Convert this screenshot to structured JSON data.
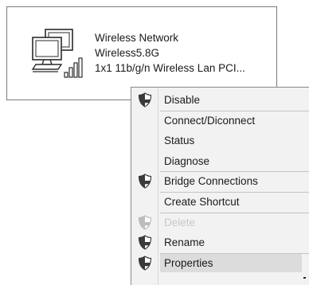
{
  "adapter": {
    "name": "Wireless Network",
    "network": "Wireless5.8G",
    "device": "1x1 11b/g/n Wireless Lan PCI...",
    "icon": "network-computers-signal-icon"
  },
  "context_menu": {
    "items": [
      {
        "label": "Disable",
        "shield": true,
        "enabled": true
      },
      {
        "label": "Connect/Diconnect",
        "shield": false,
        "enabled": true
      },
      {
        "label": "Status",
        "shield": false,
        "enabled": true
      },
      {
        "label": "Diagnose",
        "shield": false,
        "enabled": true
      },
      {
        "label": "Bridge Connections",
        "shield": true,
        "enabled": true
      },
      {
        "label": "Create Shortcut",
        "shield": false,
        "enabled": true
      },
      {
        "label": "Delete",
        "shield": true,
        "enabled": false
      },
      {
        "label": "Rename",
        "shield": true,
        "enabled": true
      },
      {
        "label": "Properties",
        "shield": true,
        "enabled": true,
        "highlighted": true
      }
    ],
    "shield_icon": "uac-shield-icon"
  },
  "colors": {
    "disabled_text": "#c8c8c8",
    "highlight": "#dcdcdc",
    "menu_background": "#f2f2f2"
  }
}
